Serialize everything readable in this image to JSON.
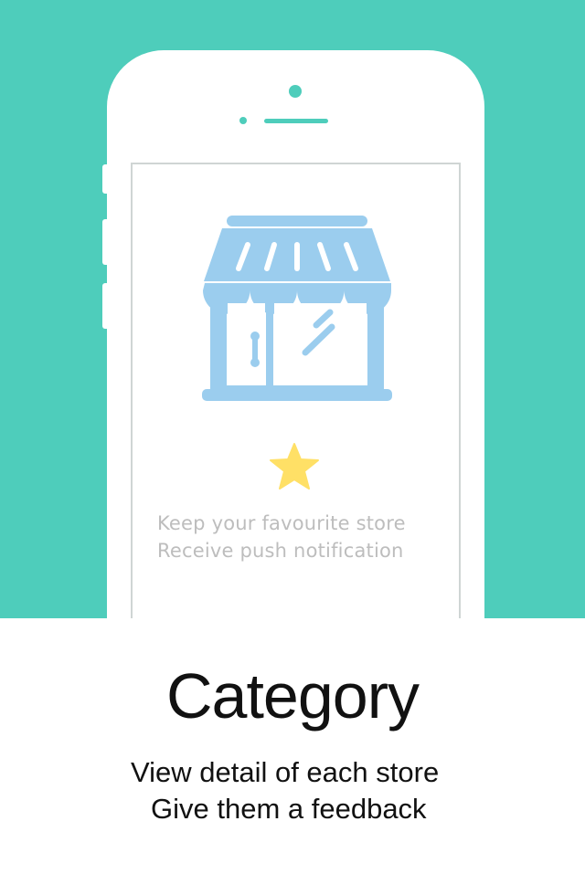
{
  "colors": {
    "background": "#4ecdbb",
    "store_icon": "#9bcdee",
    "star": "#ffe066",
    "screen_text": "#bdbdbd"
  },
  "device": {
    "icon": "smartphone-outline"
  },
  "screen": {
    "icons": [
      "store-icon",
      "star-icon"
    ],
    "lines": [
      "Keep your favourite store",
      "Receive push notification"
    ]
  },
  "caption": {
    "title": "Category",
    "lines": [
      "View detail of each store",
      "Give them a feedback"
    ]
  }
}
